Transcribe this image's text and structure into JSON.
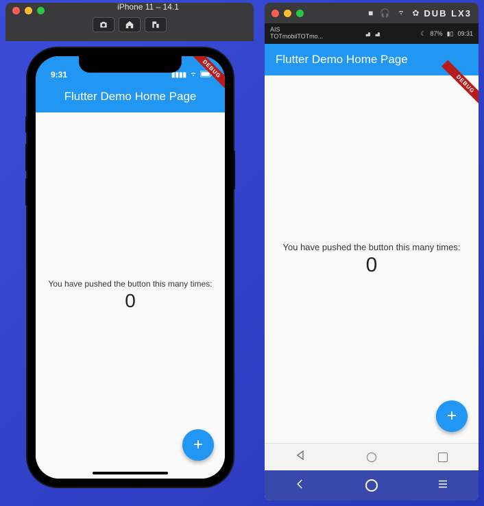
{
  "ios": {
    "window_title": "iPhone 11 – 14.1",
    "status_time": "9:31",
    "app_title": "Flutter Demo Home Page",
    "body_text": "You have pushed the button this many times:",
    "counter": "0",
    "debug_label": "DEBUG"
  },
  "android": {
    "device_label": "DUB LX3",
    "carrier_line1": "AIS",
    "carrier_line2": "TOTmobilTOTmo...",
    "battery": "87%",
    "time": "09:31",
    "app_title": "Flutter Demo Home Page",
    "body_text": "You have pushed the button this many times:",
    "counter": "0",
    "debug_label": "DEBUG"
  },
  "colors": {
    "primary": "#2196f3",
    "debug_banner": "#b71c1c",
    "android_nav": "#3949ab"
  }
}
